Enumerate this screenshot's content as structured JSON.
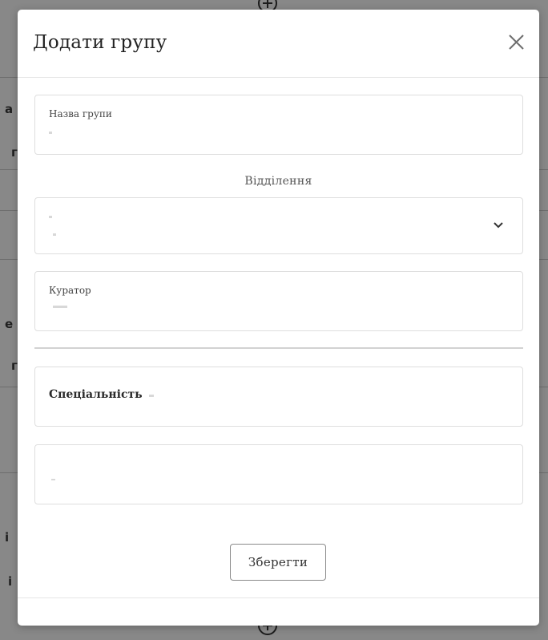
{
  "background": {
    "fragments": [
      "а",
      "г",
      "е",
      "г",
      "і",
      "і"
    ]
  },
  "modal": {
    "title": "Додати групу",
    "close_icon": "close-icon",
    "fields": {
      "group_name": {
        "label": "Назва групи",
        "value": ""
      },
      "department": {
        "section_label": "Відділення",
        "selected_value": "",
        "icon": "chevron-down-icon"
      },
      "curator": {
        "label": "Куратор",
        "value": ""
      },
      "specialty": {
        "label": "Спеціальність",
        "value": ""
      },
      "extra": {
        "value": ""
      }
    },
    "save_label": "Зберегти"
  }
}
